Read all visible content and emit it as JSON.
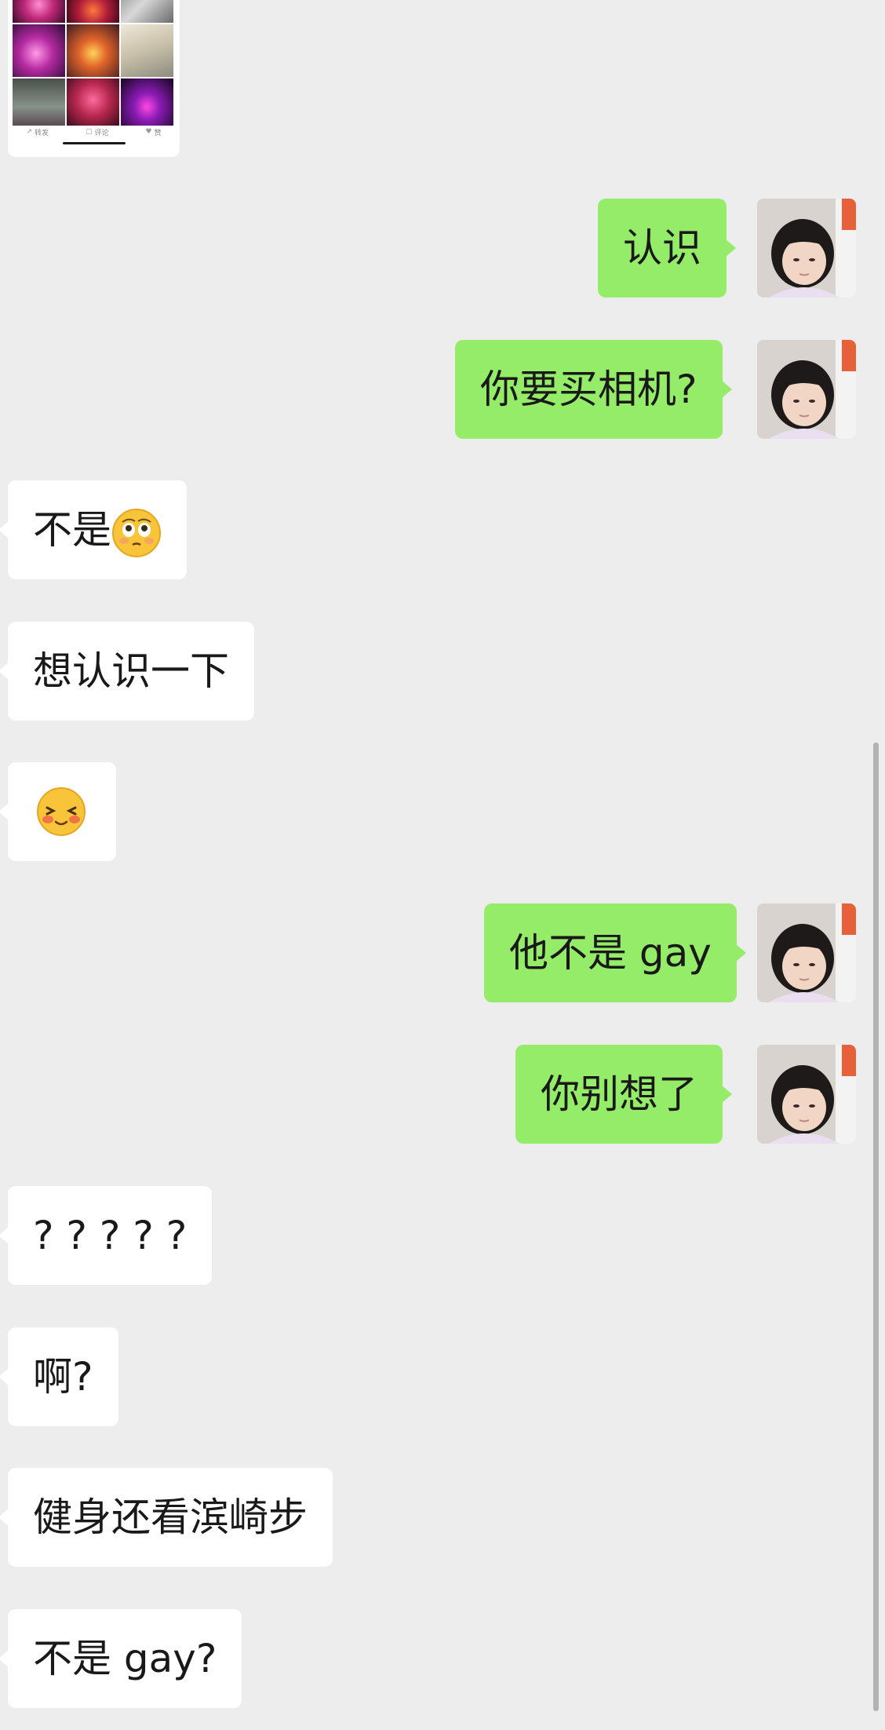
{
  "shared_card": {
    "thumbnails": [
      "photo",
      "photo",
      "photo",
      "photo",
      "photo",
      "photo",
      "photo",
      "photo",
      "photo"
    ],
    "actions": [
      {
        "icon": "share-icon",
        "label": "转发"
      },
      {
        "icon": "comment-icon",
        "label": "评论"
      },
      {
        "icon": "like-icon",
        "label": "赞"
      }
    ]
  },
  "messages": [
    {
      "side": "out",
      "text": "认识"
    },
    {
      "side": "out",
      "text": "你要买相机?"
    },
    {
      "side": "in",
      "text": "不是",
      "emoji": "flushed-face"
    },
    {
      "side": "in",
      "text": "想认识一下"
    },
    {
      "side": "in",
      "text": "",
      "emoji": "blushing-face"
    },
    {
      "side": "out",
      "text": "他不是 gay"
    },
    {
      "side": "out",
      "text": "你别想了"
    },
    {
      "side": "in",
      "text": "? ? ? ? ?"
    },
    {
      "side": "in",
      "text": "啊?"
    },
    {
      "side": "in",
      "text": "健身还看滨崎步"
    },
    {
      "side": "in",
      "text": "不是 gay?"
    }
  ],
  "colors": {
    "background": "#ededed",
    "outgoing_bubble": "#95ec69",
    "incoming_bubble": "#ffffff",
    "text": "#191919"
  }
}
